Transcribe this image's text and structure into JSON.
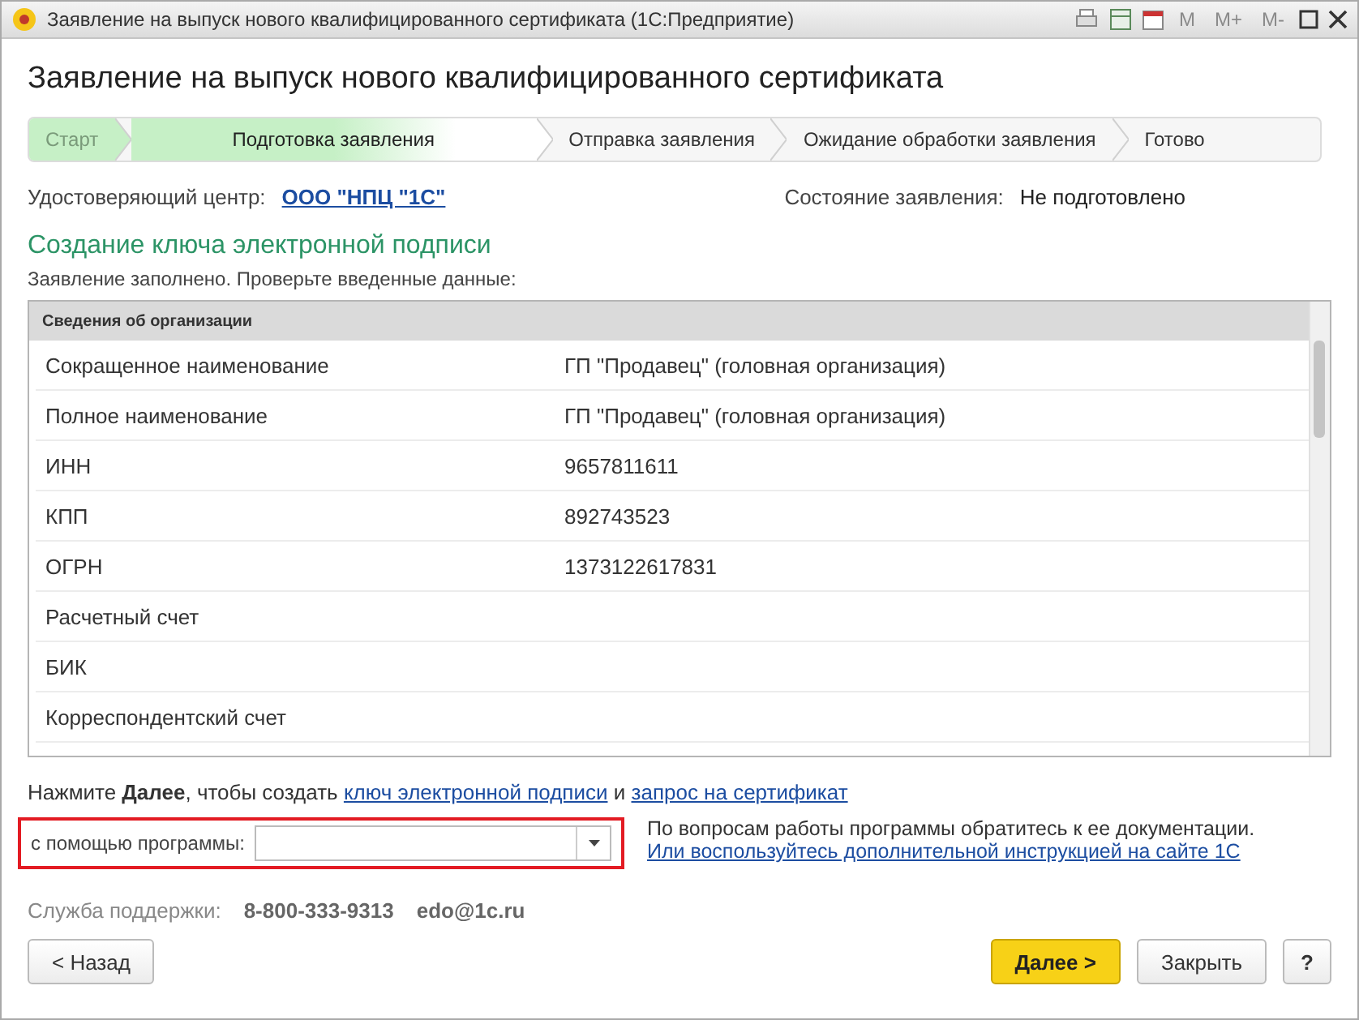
{
  "window": {
    "title": "Заявление на выпуск нового квалифицированного сертификата  (1С:Предприятие)",
    "toolbar": [
      "M",
      "M+",
      "M-"
    ]
  },
  "heading": "Заявление на выпуск нового квалифицированного сертификата",
  "steps": [
    {
      "label": "Старт",
      "done": true,
      "selected": false
    },
    {
      "label": "Подготовка заявления",
      "done": false,
      "selected": true
    },
    {
      "label": "Отправка заявления",
      "done": false,
      "selected": false
    },
    {
      "label": "Ожидание обработки заявления",
      "done": false,
      "selected": false
    },
    {
      "label": "Готово",
      "done": false,
      "selected": false
    }
  ],
  "center": {
    "label": "Удостоверяющий центр:",
    "value": "ООО \"НПЦ \"1С\""
  },
  "status": {
    "label": "Состояние заявления:",
    "value": "Не подготовлено"
  },
  "section_title": "Создание ключа электронной подписи",
  "note": "Заявление заполнено. Проверьте введенные данные:",
  "table": {
    "header": "Сведения об организации",
    "rows": [
      {
        "name": "Сокращенное наименование",
        "value": "ГП \"Продавец\" (головная организация)"
      },
      {
        "name": "Полное наименование",
        "value": "ГП \"Продавец\" (головная организация)"
      },
      {
        "name": "ИНН",
        "value": "9657811611"
      },
      {
        "name": "КПП",
        "value": "892743523"
      },
      {
        "name": "ОГРН",
        "value": "1373122617831"
      },
      {
        "name": "Расчетный счет"
      },
      {
        "name": "БИК"
      },
      {
        "name": "Корреспондентский счет"
      }
    ]
  },
  "instruction": {
    "text": "Нажмите **Далее**, чтобы создать",
    "link1": "ключ электронной подписи",
    "and": "и",
    "link2": "запрос на сертификат"
  },
  "program": {
    "label": "с помощью программы:"
  },
  "help": {
    "text": "По вопросам работы программы обратитесь к ее документации.",
    "link": "Или воспользуйтесь дополнительной инструкцией на сайте 1С"
  },
  "support": {
    "label": "Служба поддержки:",
    "phone": "8-800-333-9313",
    "email": "edo@1c.ru"
  },
  "buttons": {
    "back": "< Назад",
    "next": "Далее >",
    "close": "Закрыть",
    "help": "?"
  }
}
